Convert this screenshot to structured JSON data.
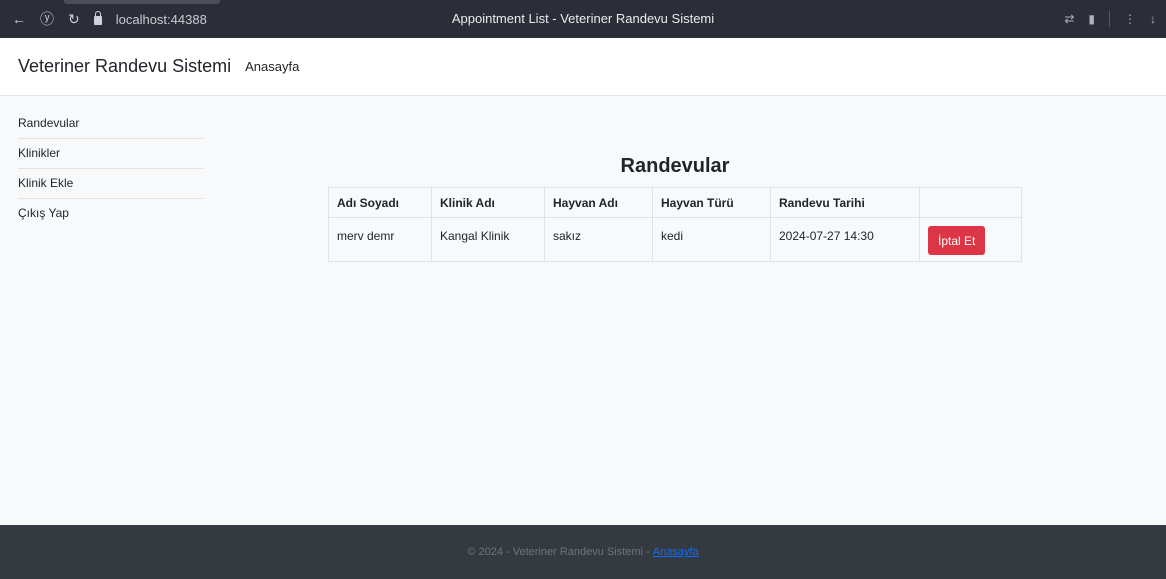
{
  "browser": {
    "url": "localhost:44388",
    "title": "Appointment List - Veteriner Randevu Sistemi",
    "icons": [
      "back-arrow-icon",
      "yandex-icon",
      "reload-icon",
      "lock-icon",
      "translate-icon",
      "bookmark-icon",
      "download-icon"
    ]
  },
  "navbar": {
    "brand": "Veteriner Randevu Sistemi",
    "home_link": "Anasayfa"
  },
  "sidebar": {
    "items": [
      {
        "label": "Randevular"
      },
      {
        "label": "Klinikler"
      },
      {
        "label": "Klinik Ekle"
      },
      {
        "label": "Çıkış Yap"
      }
    ]
  },
  "main": {
    "title": "Randevular",
    "table": {
      "headers": [
        "Adı Soyadı",
        "Klinik Adı",
        "Hayvan Adı",
        "Hayvan Türü",
        "Randevu Tarihi",
        ""
      ],
      "rows": [
        {
          "name": "merv demr",
          "clinic": "Kangal Klinik",
          "pet_name": "sakız",
          "pet_type": "kedi",
          "date": "2024-07-27 14:30",
          "action_label": "İptal Et"
        }
      ]
    }
  },
  "footer": {
    "text": "© 2024 - Veteriner Randevu Sistemi - ",
    "link": "Anasayfa"
  },
  "colors": {
    "danger": "#dc3545",
    "footer_bg": "#343a40",
    "link": "#0d6efd",
    "chrome_bg": "#2b2e38"
  }
}
